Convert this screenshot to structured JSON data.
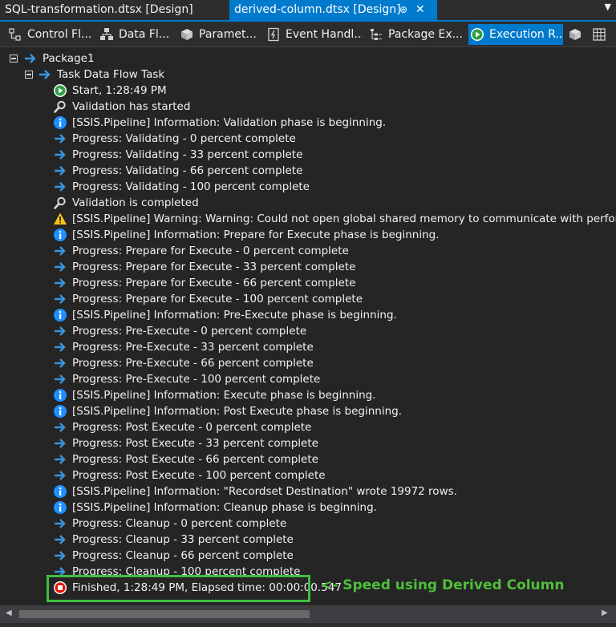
{
  "tabs": {
    "inactive": "SQL-transformation.dtsx [Design]",
    "active": "derived-column.dtsx [Design]",
    "pin_icon": "pin-icon",
    "close_icon": "close-icon",
    "menu_icon": "dropdown-icon"
  },
  "designer_tabs": [
    {
      "label": "Control Fl...",
      "icon": "control-flow-icon"
    },
    {
      "label": "Data Fl...",
      "icon": "data-flow-icon"
    },
    {
      "label": "Paramet...",
      "icon": "parameters-icon"
    },
    {
      "label": "Event Handl...",
      "icon": "event-handlers-icon"
    },
    {
      "label": "Package Ex...",
      "icon": "package-explorer-icon"
    },
    {
      "label": "Execution R...",
      "icon": "execution-results-icon"
    }
  ],
  "tree": {
    "root": "Package1",
    "task": "Task Data Flow Task",
    "messages": [
      {
        "icon": "start",
        "text": "Start, 1:28:49 PM"
      },
      {
        "icon": "validation",
        "text": "Validation has started"
      },
      {
        "icon": "info",
        "text": "[SSIS.Pipeline] Information: Validation phase is beginning."
      },
      {
        "icon": "progress",
        "text": "Progress: Validating - 0 percent complete"
      },
      {
        "icon": "progress",
        "text": "Progress: Validating - 33 percent complete"
      },
      {
        "icon": "progress",
        "text": "Progress: Validating - 66 percent complete"
      },
      {
        "icon": "progress",
        "text": "Progress: Validating - 100 percent complete"
      },
      {
        "icon": "validation",
        "text": "Validation is completed"
      },
      {
        "icon": "warning",
        "text": "[SSIS.Pipeline] Warning: Warning: Could not open global shared memory to communicate with performance DLL; d"
      },
      {
        "icon": "info",
        "text": "[SSIS.Pipeline] Information: Prepare for Execute phase is beginning."
      },
      {
        "icon": "progress",
        "text": "Progress: Prepare for Execute - 0 percent complete"
      },
      {
        "icon": "progress",
        "text": "Progress: Prepare for Execute - 33 percent complete"
      },
      {
        "icon": "progress",
        "text": "Progress: Prepare for Execute - 66 percent complete"
      },
      {
        "icon": "progress",
        "text": "Progress: Prepare for Execute - 100 percent complete"
      },
      {
        "icon": "info",
        "text": "[SSIS.Pipeline] Information: Pre-Execute phase is beginning."
      },
      {
        "icon": "progress",
        "text": "Progress: Pre-Execute - 0 percent complete"
      },
      {
        "icon": "progress",
        "text": "Progress: Pre-Execute - 33 percent complete"
      },
      {
        "icon": "progress",
        "text": "Progress: Pre-Execute - 66 percent complete"
      },
      {
        "icon": "progress",
        "text": "Progress: Pre-Execute - 100 percent complete"
      },
      {
        "icon": "info",
        "text": "[SSIS.Pipeline] Information: Execute phase is beginning."
      },
      {
        "icon": "info",
        "text": "[SSIS.Pipeline] Information: Post Execute phase is beginning."
      },
      {
        "icon": "progress",
        "text": "Progress: Post Execute - 0 percent complete"
      },
      {
        "icon": "progress",
        "text": "Progress: Post Execute - 33 percent complete"
      },
      {
        "icon": "progress",
        "text": "Progress: Post Execute - 66 percent complete"
      },
      {
        "icon": "progress",
        "text": "Progress: Post Execute - 100 percent complete"
      },
      {
        "icon": "info",
        "text": "[SSIS.Pipeline] Information: \"Recordset Destination\" wrote 19972 rows."
      },
      {
        "icon": "info",
        "text": "[SSIS.Pipeline] Information: Cleanup phase is beginning."
      },
      {
        "icon": "progress",
        "text": "Progress: Cleanup - 0 percent complete"
      },
      {
        "icon": "progress",
        "text": "Progress: Cleanup - 33 percent complete"
      },
      {
        "icon": "progress",
        "text": "Progress: Cleanup - 66 percent complete"
      },
      {
        "icon": "progress",
        "text": "Progress: Cleanup - 100 percent complete"
      },
      {
        "icon": "finished",
        "text": "Finished, 1:28:49 PM, Elapsed time: 00:00:00.547"
      }
    ]
  },
  "annotation": "<- Speed using Derived Column",
  "colors": {
    "accent": "#007acc",
    "highlight": "#3fbf3f",
    "annotation": "#4fbf3a",
    "info": "#1e90ff",
    "warning": "#f5c518",
    "stop": "#e51400",
    "start": "#2ea043"
  }
}
